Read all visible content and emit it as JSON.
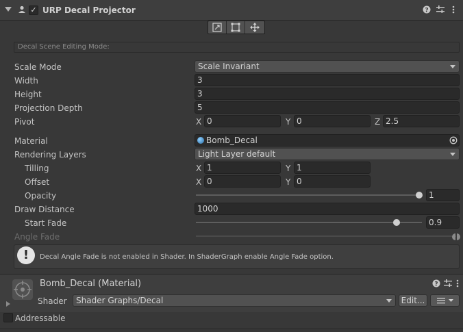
{
  "component": {
    "title": "URP Decal Projector",
    "enabled_check": "✓"
  },
  "toolbar": {
    "buttons": [
      "edit-bounds",
      "edit-pivot",
      "edit-uv"
    ]
  },
  "edit_mode": {
    "label": "Decal Scene Editing Mode:"
  },
  "fields": {
    "scale_mode": {
      "label": "Scale Mode",
      "value": "Scale Invariant"
    },
    "width": {
      "label": "Width",
      "value": "3"
    },
    "height": {
      "label": "Height",
      "value": "3"
    },
    "projection_depth": {
      "label": "Projection Depth",
      "value": "5"
    },
    "pivot": {
      "label": "Pivot",
      "x_label": "X",
      "x": "0",
      "y_label": "Y",
      "y": "0",
      "z_label": "Z",
      "z": "2.5"
    },
    "material": {
      "label": "Material",
      "value": "Bomb_Decal"
    },
    "rendering_layers": {
      "label": "Rendering Layers",
      "value": "Light Layer default"
    },
    "tilling": {
      "label": "Tilling",
      "x_label": "X",
      "x": "1",
      "y_label": "Y",
      "y": "1"
    },
    "offset": {
      "label": "Offset",
      "x_label": "X",
      "x": "0",
      "y_label": "Y",
      "y": "0"
    },
    "opacity": {
      "label": "Opacity",
      "value": "1",
      "fraction": 1.0
    },
    "draw_distance": {
      "label": "Draw Distance",
      "value": "1000"
    },
    "start_fade": {
      "label": "Start Fade",
      "value": "0.9",
      "fraction": 0.9
    },
    "angle_fade": {
      "label": "Angle Fade"
    }
  },
  "help": {
    "icon": "!",
    "text": "Decal Angle Fade is not enabled in Shader. In ShaderGraph enable Angle Fade option."
  },
  "material_section": {
    "title": "Bomb_Decal (Material)",
    "shader_label": "Shader",
    "shader_value": "Shader Graphs/Decal",
    "edit_button": "Edit...",
    "addressable_label": "Addressable"
  },
  "colors": {
    "background": "#383838",
    "field": "#2a2a2a",
    "text": "#c4c4c4"
  }
}
